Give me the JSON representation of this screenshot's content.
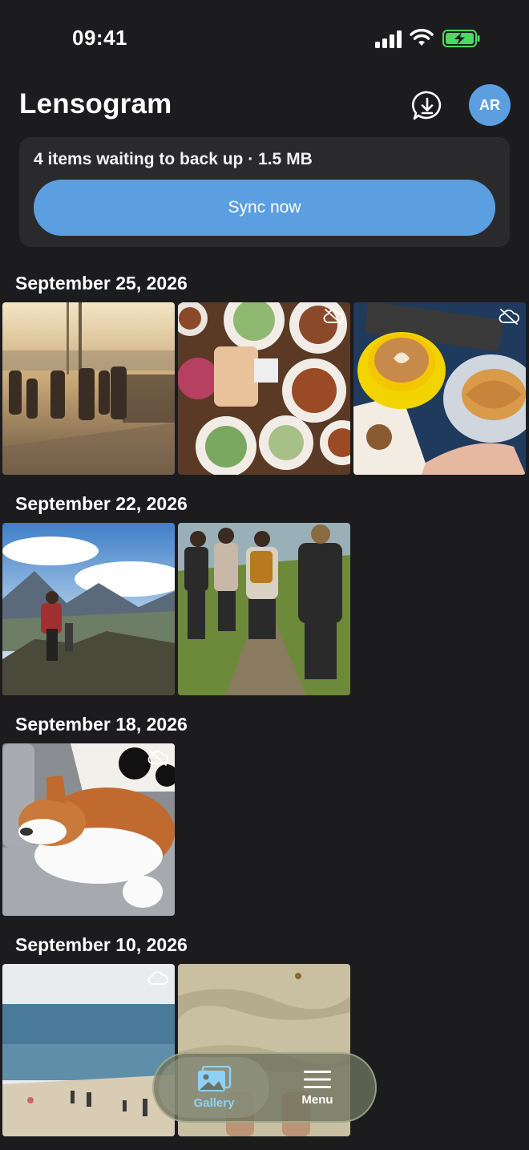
{
  "status_bar": {
    "time": "09:41"
  },
  "header": {
    "title": "Lensogram",
    "avatar_initials": "AR"
  },
  "backup": {
    "message": "4 items waiting to back up · 1.5 MB",
    "sync_label": "Sync now"
  },
  "sections": [
    {
      "date": "September 25, 2026",
      "photos": [
        "friends-walking-sunset",
        "food-table-spread",
        "latte-croissant"
      ]
    },
    {
      "date": "September 22, 2026",
      "photos": [
        "hiker-mountain-view",
        "group-hiking-trail"
      ]
    },
    {
      "date": "September 18, 2026",
      "photos": [
        "corgi-sleeping-sofa"
      ]
    },
    {
      "date": "September 10, 2026",
      "photos": [
        "beach-sea",
        "sandy-shallow-water"
      ]
    }
  ],
  "bottom_nav": {
    "gallery_label": "Gallery",
    "menu_label": "Menu"
  },
  "colors": {
    "background": "#1c1c1e",
    "accent": "#5b9fe0",
    "card": "#2a2a2c",
    "nav_active": "#8fd0f5"
  }
}
